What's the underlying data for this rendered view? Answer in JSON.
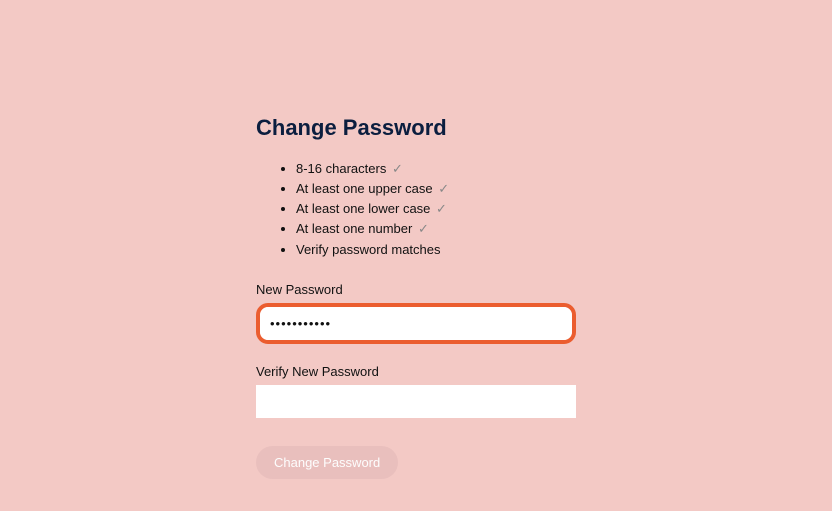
{
  "heading": "Change Password",
  "requirements": {
    "item1": {
      "text": "8-16 characters ",
      "check": "✓"
    },
    "item2": {
      "text": "At least one upper case ",
      "check": "✓"
    },
    "item3": {
      "text": "At least one lower case ",
      "check": "✓"
    },
    "item4": {
      "text": "At least one number ",
      "check": "✓"
    },
    "item5": {
      "text": "Verify password matches",
      "check": ""
    }
  },
  "fields": {
    "newPassword": {
      "label": "New Password",
      "value": "•••••••••••"
    },
    "verifyPassword": {
      "label": "Verify New Password",
      "value": ""
    }
  },
  "button": {
    "label": "Change Password"
  }
}
